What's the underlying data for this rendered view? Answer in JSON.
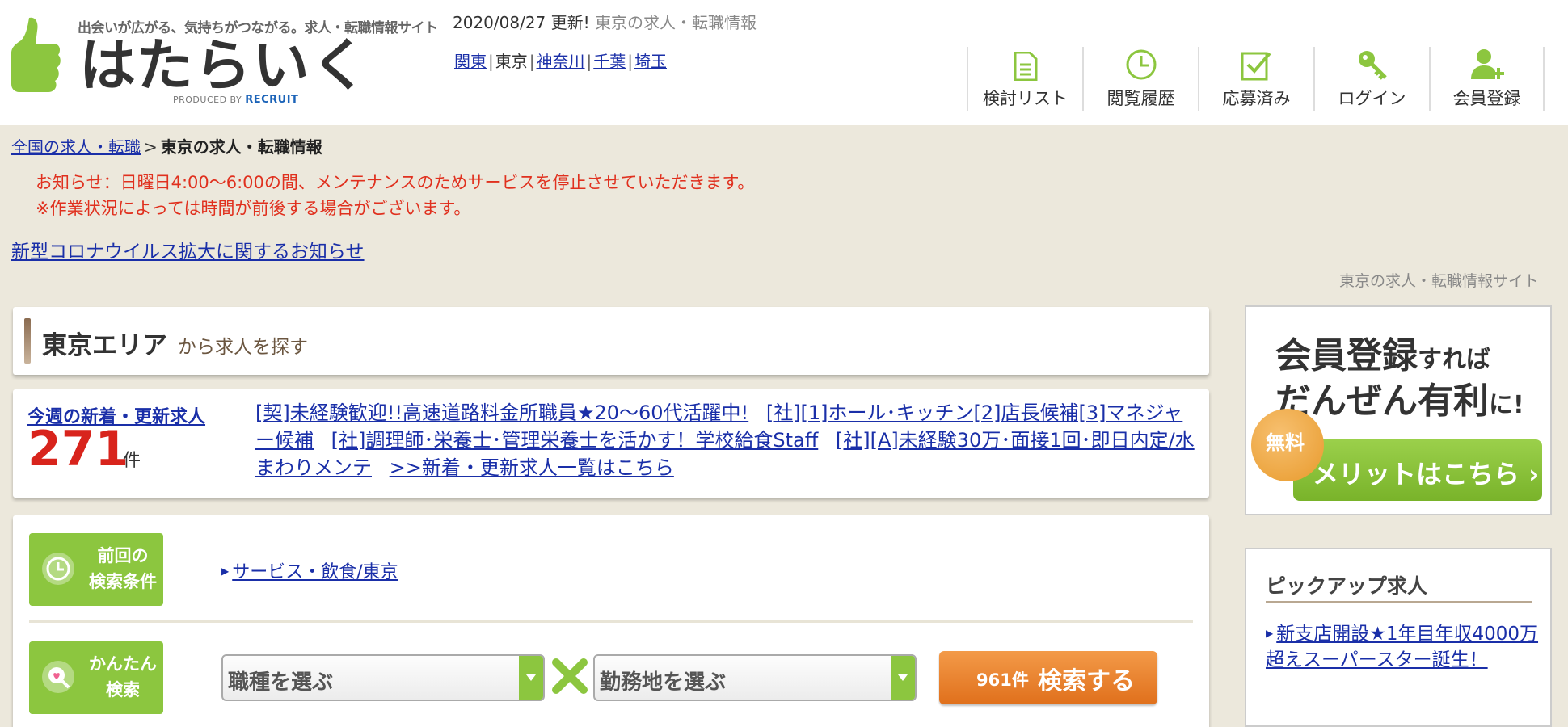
{
  "header": {
    "tagline": "出会いが広がる、気持ちがつながる。求人・転職情報サイト",
    "brand": "はたらいく",
    "produced_by": "PRODUCED BY",
    "produced_company": "RECRUIT",
    "update_date": "2020/08/27 更新!",
    "update_sub": "東京の求人・転職情報",
    "areas": [
      {
        "label": "関東"
      },
      {
        "label": "東京"
      },
      {
        "label": "神奈川"
      },
      {
        "label": "千葉"
      },
      {
        "label": "埼玉"
      }
    ],
    "nav": [
      {
        "label": "検討リスト",
        "icon": "document-icon"
      },
      {
        "label": "閲覧履歴",
        "icon": "clock-icon"
      },
      {
        "label": "応募済み",
        "icon": "checkbox-icon"
      },
      {
        "label": "ログイン",
        "icon": "key-icon"
      },
      {
        "label": "会員登録",
        "icon": "add-user-icon"
      }
    ]
  },
  "breadcrumb": {
    "root": "全国の求人・転職",
    "separator": ">",
    "current": "東京の求人・転職情報"
  },
  "notice": {
    "line1": "お知らせ：日曜日4:00〜6:00の間、メンテナンスのためサービスを停止させていただきます。",
    "line2": "※作業状況によっては時間が前後する場合がございます。"
  },
  "covid_link": "新型コロナウイルス拡大に関するお知らせ",
  "site_caption": "東京の求人・転職情報サイト",
  "area_search": {
    "title": "東京エリア",
    "subtitle": "から求人を探す"
  },
  "new_jobs": {
    "label": "今週の新着・更新求人",
    "count": "271",
    "unit": "件",
    "links": [
      "[契]未経験歓迎!!高速道路料金所職員★20〜60代活躍中!",
      "[社][1]ホール･キッチン[2]店長候補[3]マネジャー候補",
      "[社]調理師･栄養士･管理栄養士を活かす！学校給食Staff",
      "[社][A]未経験30万･面接1回･即日内定/水まわりメンテ",
      ">>新着・更新求人一覧はこちら"
    ]
  },
  "search": {
    "prev_tag": [
      "前回の",
      "検索条件"
    ],
    "prev_condition": "サービス・飲食/東京",
    "easy_tag": [
      "かんたん",
      "検索"
    ],
    "job_type_select": "職種を選ぶ",
    "location_select": "勤務地を選ぶ",
    "result_count": "961件",
    "search_button": "検索する"
  },
  "banner": {
    "line1_main": "会員登録",
    "line1_sub": "すれば",
    "line2_main": "だんぜん有利",
    "line2_sub": "に!",
    "free_badge": "無料",
    "merit_button": "メリットはこちら ›"
  },
  "pickup": {
    "title": "ピックアップ求人",
    "job": "新支店開設★1年目年収4000万超えスーパースター誕生！"
  },
  "colors": {
    "brand_green": "#8cc63f",
    "search_orange": "#e8802c",
    "notice_red": "#e0301e",
    "count_red": "#d8241c",
    "link_blue": "#1a2fa8",
    "page_beige": "#ece8dc"
  }
}
